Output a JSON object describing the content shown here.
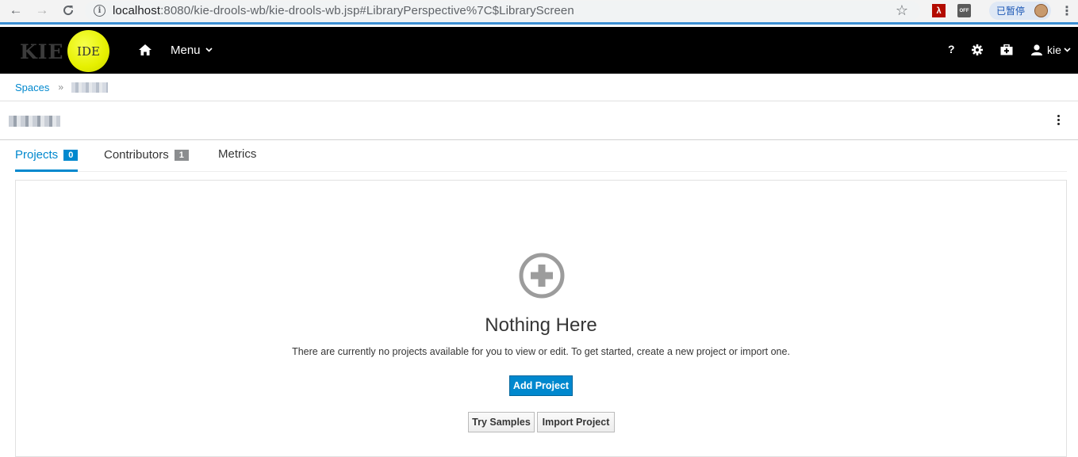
{
  "browser": {
    "url_host": "localhost",
    "url_rest": ":8080/kie-drools-wb/kie-drools-wb.jsp#LibraryPerspective%7C$LibraryScreen",
    "paused_label": "已暂停",
    "ext_off_label": "OFF"
  },
  "app": {
    "logo_kie": "KIE",
    "logo_ide": "IDE",
    "menu_label": "Menu",
    "help_label": "?",
    "user_label": "kie"
  },
  "breadcrumb": {
    "spaces_label": "Spaces"
  },
  "tabs": [
    {
      "label": "Projects",
      "count": "0"
    },
    {
      "label": "Contributors",
      "count": "1"
    },
    {
      "label": "Metrics"
    }
  ],
  "empty_state": {
    "title": "Nothing Here",
    "text": "There are currently no projects available for you to view or edit. To get started, create a new project or import one.",
    "add_project": "Add Project",
    "try_samples": "Try Samples",
    "import_project": "Import Project"
  },
  "colors": {
    "accent": "#0088ce",
    "nav_bg": "#000000",
    "badge_grey": "#8b8d8f"
  }
}
